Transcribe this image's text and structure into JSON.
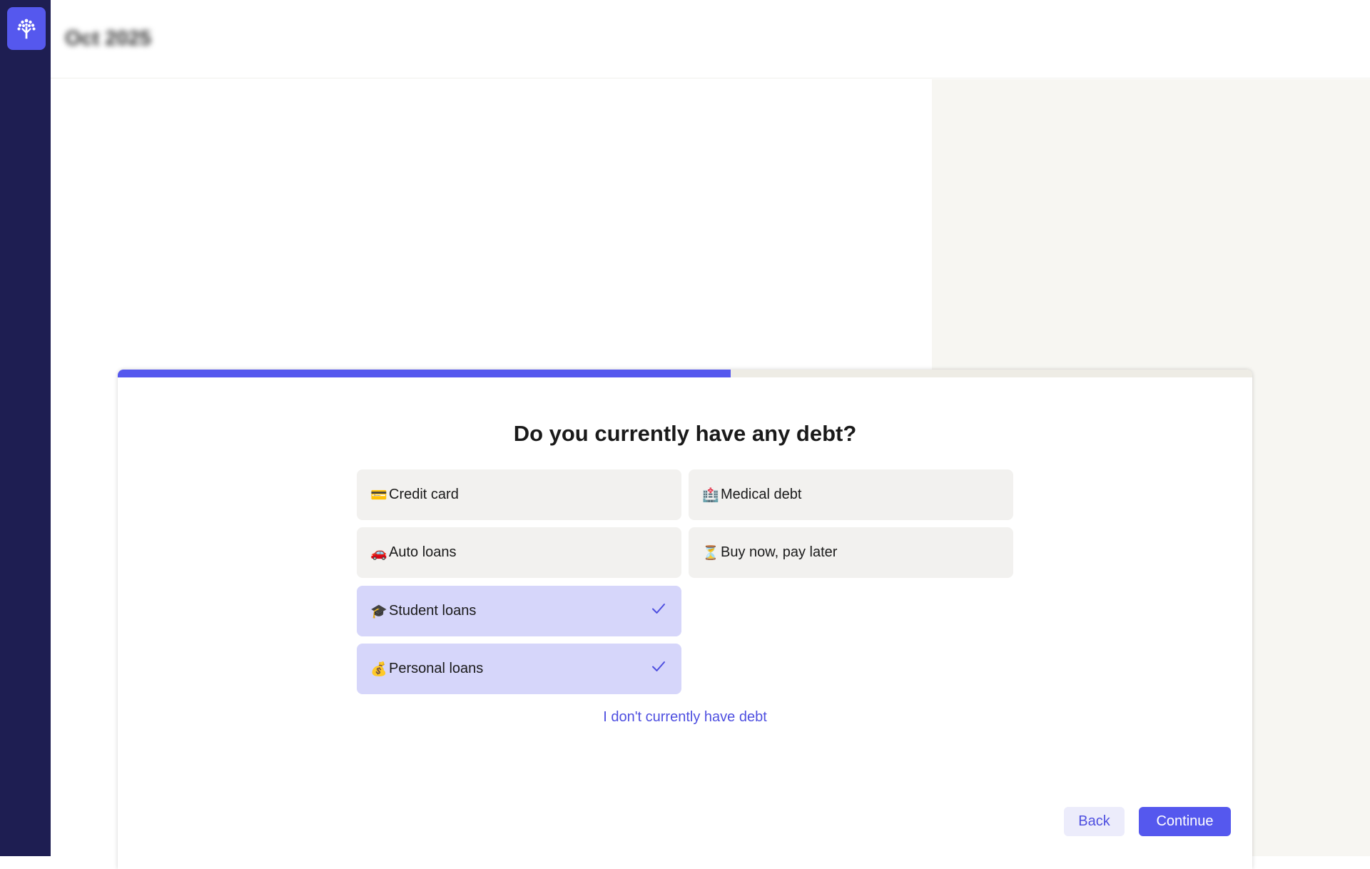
{
  "header": {
    "period": "Oct 2025"
  },
  "colors": {
    "sidebar": "#1e1e52",
    "accent": "#5558ee",
    "selected_option": "#d6d6fa",
    "option": "#f2f1ef"
  },
  "progress": {
    "fraction": 0.54
  },
  "modal": {
    "question": "Do you currently have any debt?",
    "options": [
      {
        "emoji": "💳",
        "label": "Credit card",
        "selected": false
      },
      {
        "emoji": "🏥",
        "label": "Medical debt",
        "selected": false
      },
      {
        "emoji": "🚗",
        "label": "Auto loans",
        "selected": false
      },
      {
        "emoji": "⏳",
        "label": "Buy now, pay later",
        "selected": false
      },
      {
        "emoji": "🎓",
        "label": "Student loans",
        "selected": true
      },
      {
        "emoji": "💰",
        "label": "Personal loans",
        "selected": true
      }
    ],
    "no_debt_link": "I don't currently have debt",
    "back_label": "Back",
    "continue_label": "Continue"
  },
  "icons": {
    "logo": "tree-logo-icon",
    "check": "checkmark-icon"
  }
}
